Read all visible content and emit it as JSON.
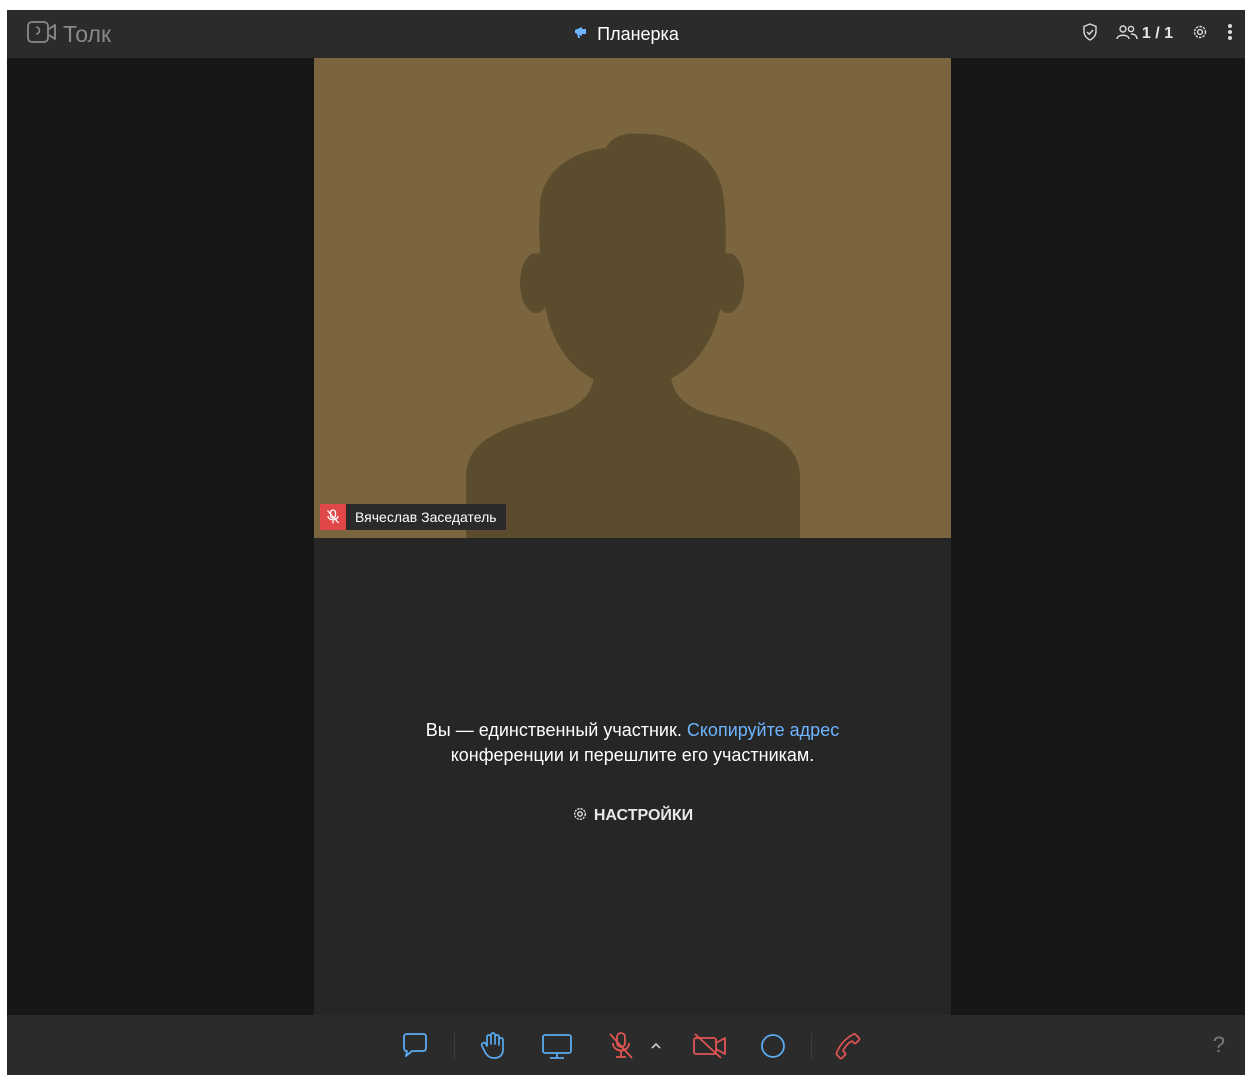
{
  "app": {
    "brand": "Толк"
  },
  "conference": {
    "title": "Планерка"
  },
  "topbar": {
    "participants_count": "1 / 1"
  },
  "participant": {
    "name": "Вячеслав Заседатель",
    "mic_state": "muted"
  },
  "empty_state": {
    "text_before_link": "Вы — единственный участник. ",
    "link_text": "Скопируйте адрес",
    "text_after_link": " конференции и перешлите его участникам.",
    "settings_label": "НАСТРОЙКИ"
  },
  "toolbar": {
    "help_label": "?"
  },
  "colors": {
    "background": "#171717",
    "bar": "#2b2b2b",
    "tile": "#262626",
    "video_bg": "#7b653e",
    "silhouette": "#5c4c2e",
    "accent": "#6eb4ff",
    "muted_red": "#e04848"
  },
  "icons": {
    "brand": "video-camera-icon",
    "title": "megaphone-icon",
    "security": "shield-check-icon",
    "participants": "people-icon",
    "settings": "gear-icon",
    "more": "kebab-menu-icon",
    "chat": "chat-bubble-icon",
    "hand": "raise-hand-icon",
    "screen": "screen-share-icon",
    "mic": "mic-off-icon",
    "camera": "camera-off-icon",
    "record": "record-circle-icon",
    "hangup": "phone-hangup-icon"
  }
}
